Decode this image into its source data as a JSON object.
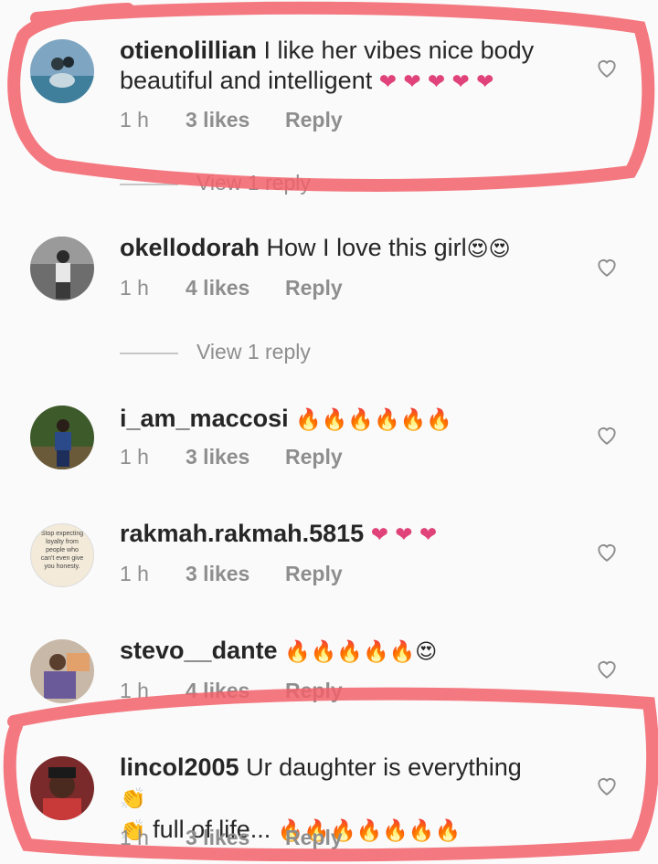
{
  "comments": [
    {
      "username": "otienolillian",
      "text": "I like her vibes nice body beautiful and intelligent",
      "emojis": [
        "heart",
        "heart",
        "heart",
        "heart",
        "heart"
      ],
      "time": "1 h",
      "likes": "3 likes",
      "reply": "Reply",
      "view_replies": "View 1 reply"
    },
    {
      "username": "okellodorah",
      "text": "How I love this girl",
      "emojis": [
        "heart-eyes",
        "heart-eyes"
      ],
      "time": "1 h",
      "likes": "4 likes",
      "reply": "Reply",
      "view_replies": "View 1 reply"
    },
    {
      "username": "i_am_maccosi",
      "text": "",
      "emojis": [
        "fire",
        "fire",
        "fire",
        "fire",
        "fire",
        "fire"
      ],
      "time": "1 h",
      "likes": "3 likes",
      "reply": "Reply"
    },
    {
      "username": "rakmah.rakmah.5815",
      "text": "",
      "emojis": [
        "heart",
        "heart",
        "heart"
      ],
      "avatar_text": "Stop expecting loyalty from people who can't even give you honesty.",
      "time": "1 h",
      "likes": "3 likes",
      "reply": "Reply"
    },
    {
      "username": "stevo__dante",
      "text": "",
      "emojis": [
        "fire",
        "fire",
        "fire",
        "fire",
        "fire",
        "heart-eyes"
      ],
      "time": "1 h",
      "likes": "4 likes",
      "reply": "Reply"
    },
    {
      "username": "lincol2005",
      "text": "Ur daughter is everything",
      "text2": "full of life...",
      "emojis": [
        "clap"
      ],
      "emojis2_before": [
        "clap"
      ],
      "emojis2_after": [
        "fire",
        "fire",
        "fire",
        "fire",
        "fire",
        "fire",
        "fire"
      ],
      "time": "1 h",
      "likes": "3 likes",
      "reply": "Reply"
    }
  ],
  "colors": {
    "highlight": "#f2606a",
    "meta": "#8e8e8e",
    "heart": "#e0437a",
    "fire": "#f07a16"
  },
  "icons": {
    "like": "heart-outline-icon"
  }
}
